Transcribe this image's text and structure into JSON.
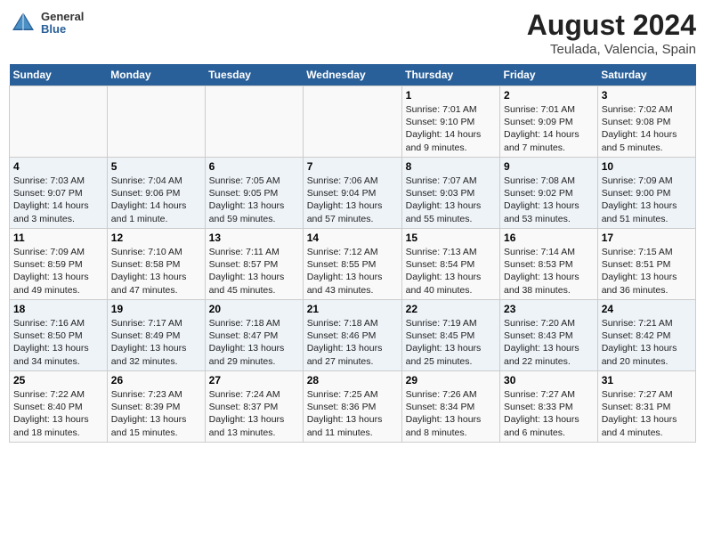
{
  "logo": {
    "general": "General",
    "blue": "Blue"
  },
  "title": "August 2024",
  "subtitle": "Teulada, Valencia, Spain",
  "days_of_week": [
    "Sunday",
    "Monday",
    "Tuesday",
    "Wednesday",
    "Thursday",
    "Friday",
    "Saturday"
  ],
  "weeks": [
    [
      {
        "day": "",
        "info": ""
      },
      {
        "day": "",
        "info": ""
      },
      {
        "day": "",
        "info": ""
      },
      {
        "day": "",
        "info": ""
      },
      {
        "day": "1",
        "info": "Sunrise: 7:01 AM\nSunset: 9:10 PM\nDaylight: 14 hours\nand 9 minutes."
      },
      {
        "day": "2",
        "info": "Sunrise: 7:01 AM\nSunset: 9:09 PM\nDaylight: 14 hours\nand 7 minutes."
      },
      {
        "day": "3",
        "info": "Sunrise: 7:02 AM\nSunset: 9:08 PM\nDaylight: 14 hours\nand 5 minutes."
      }
    ],
    [
      {
        "day": "4",
        "info": "Sunrise: 7:03 AM\nSunset: 9:07 PM\nDaylight: 14 hours\nand 3 minutes."
      },
      {
        "day": "5",
        "info": "Sunrise: 7:04 AM\nSunset: 9:06 PM\nDaylight: 14 hours\nand 1 minute."
      },
      {
        "day": "6",
        "info": "Sunrise: 7:05 AM\nSunset: 9:05 PM\nDaylight: 13 hours\nand 59 minutes."
      },
      {
        "day": "7",
        "info": "Sunrise: 7:06 AM\nSunset: 9:04 PM\nDaylight: 13 hours\nand 57 minutes."
      },
      {
        "day": "8",
        "info": "Sunrise: 7:07 AM\nSunset: 9:03 PM\nDaylight: 13 hours\nand 55 minutes."
      },
      {
        "day": "9",
        "info": "Sunrise: 7:08 AM\nSunset: 9:02 PM\nDaylight: 13 hours\nand 53 minutes."
      },
      {
        "day": "10",
        "info": "Sunrise: 7:09 AM\nSunset: 9:00 PM\nDaylight: 13 hours\nand 51 minutes."
      }
    ],
    [
      {
        "day": "11",
        "info": "Sunrise: 7:09 AM\nSunset: 8:59 PM\nDaylight: 13 hours\nand 49 minutes."
      },
      {
        "day": "12",
        "info": "Sunrise: 7:10 AM\nSunset: 8:58 PM\nDaylight: 13 hours\nand 47 minutes."
      },
      {
        "day": "13",
        "info": "Sunrise: 7:11 AM\nSunset: 8:57 PM\nDaylight: 13 hours\nand 45 minutes."
      },
      {
        "day": "14",
        "info": "Sunrise: 7:12 AM\nSunset: 8:55 PM\nDaylight: 13 hours\nand 43 minutes."
      },
      {
        "day": "15",
        "info": "Sunrise: 7:13 AM\nSunset: 8:54 PM\nDaylight: 13 hours\nand 40 minutes."
      },
      {
        "day": "16",
        "info": "Sunrise: 7:14 AM\nSunset: 8:53 PM\nDaylight: 13 hours\nand 38 minutes."
      },
      {
        "day": "17",
        "info": "Sunrise: 7:15 AM\nSunset: 8:51 PM\nDaylight: 13 hours\nand 36 minutes."
      }
    ],
    [
      {
        "day": "18",
        "info": "Sunrise: 7:16 AM\nSunset: 8:50 PM\nDaylight: 13 hours\nand 34 minutes."
      },
      {
        "day": "19",
        "info": "Sunrise: 7:17 AM\nSunset: 8:49 PM\nDaylight: 13 hours\nand 32 minutes."
      },
      {
        "day": "20",
        "info": "Sunrise: 7:18 AM\nSunset: 8:47 PM\nDaylight: 13 hours\nand 29 minutes."
      },
      {
        "day": "21",
        "info": "Sunrise: 7:18 AM\nSunset: 8:46 PM\nDaylight: 13 hours\nand 27 minutes."
      },
      {
        "day": "22",
        "info": "Sunrise: 7:19 AM\nSunset: 8:45 PM\nDaylight: 13 hours\nand 25 minutes."
      },
      {
        "day": "23",
        "info": "Sunrise: 7:20 AM\nSunset: 8:43 PM\nDaylight: 13 hours\nand 22 minutes."
      },
      {
        "day": "24",
        "info": "Sunrise: 7:21 AM\nSunset: 8:42 PM\nDaylight: 13 hours\nand 20 minutes."
      }
    ],
    [
      {
        "day": "25",
        "info": "Sunrise: 7:22 AM\nSunset: 8:40 PM\nDaylight: 13 hours\nand 18 minutes."
      },
      {
        "day": "26",
        "info": "Sunrise: 7:23 AM\nSunset: 8:39 PM\nDaylight: 13 hours\nand 15 minutes."
      },
      {
        "day": "27",
        "info": "Sunrise: 7:24 AM\nSunset: 8:37 PM\nDaylight: 13 hours\nand 13 minutes."
      },
      {
        "day": "28",
        "info": "Sunrise: 7:25 AM\nSunset: 8:36 PM\nDaylight: 13 hours\nand 11 minutes."
      },
      {
        "day": "29",
        "info": "Sunrise: 7:26 AM\nSunset: 8:34 PM\nDaylight: 13 hours\nand 8 minutes."
      },
      {
        "day": "30",
        "info": "Sunrise: 7:27 AM\nSunset: 8:33 PM\nDaylight: 13 hours\nand 6 minutes."
      },
      {
        "day": "31",
        "info": "Sunrise: 7:27 AM\nSunset: 8:31 PM\nDaylight: 13 hours\nand 4 minutes."
      }
    ]
  ]
}
